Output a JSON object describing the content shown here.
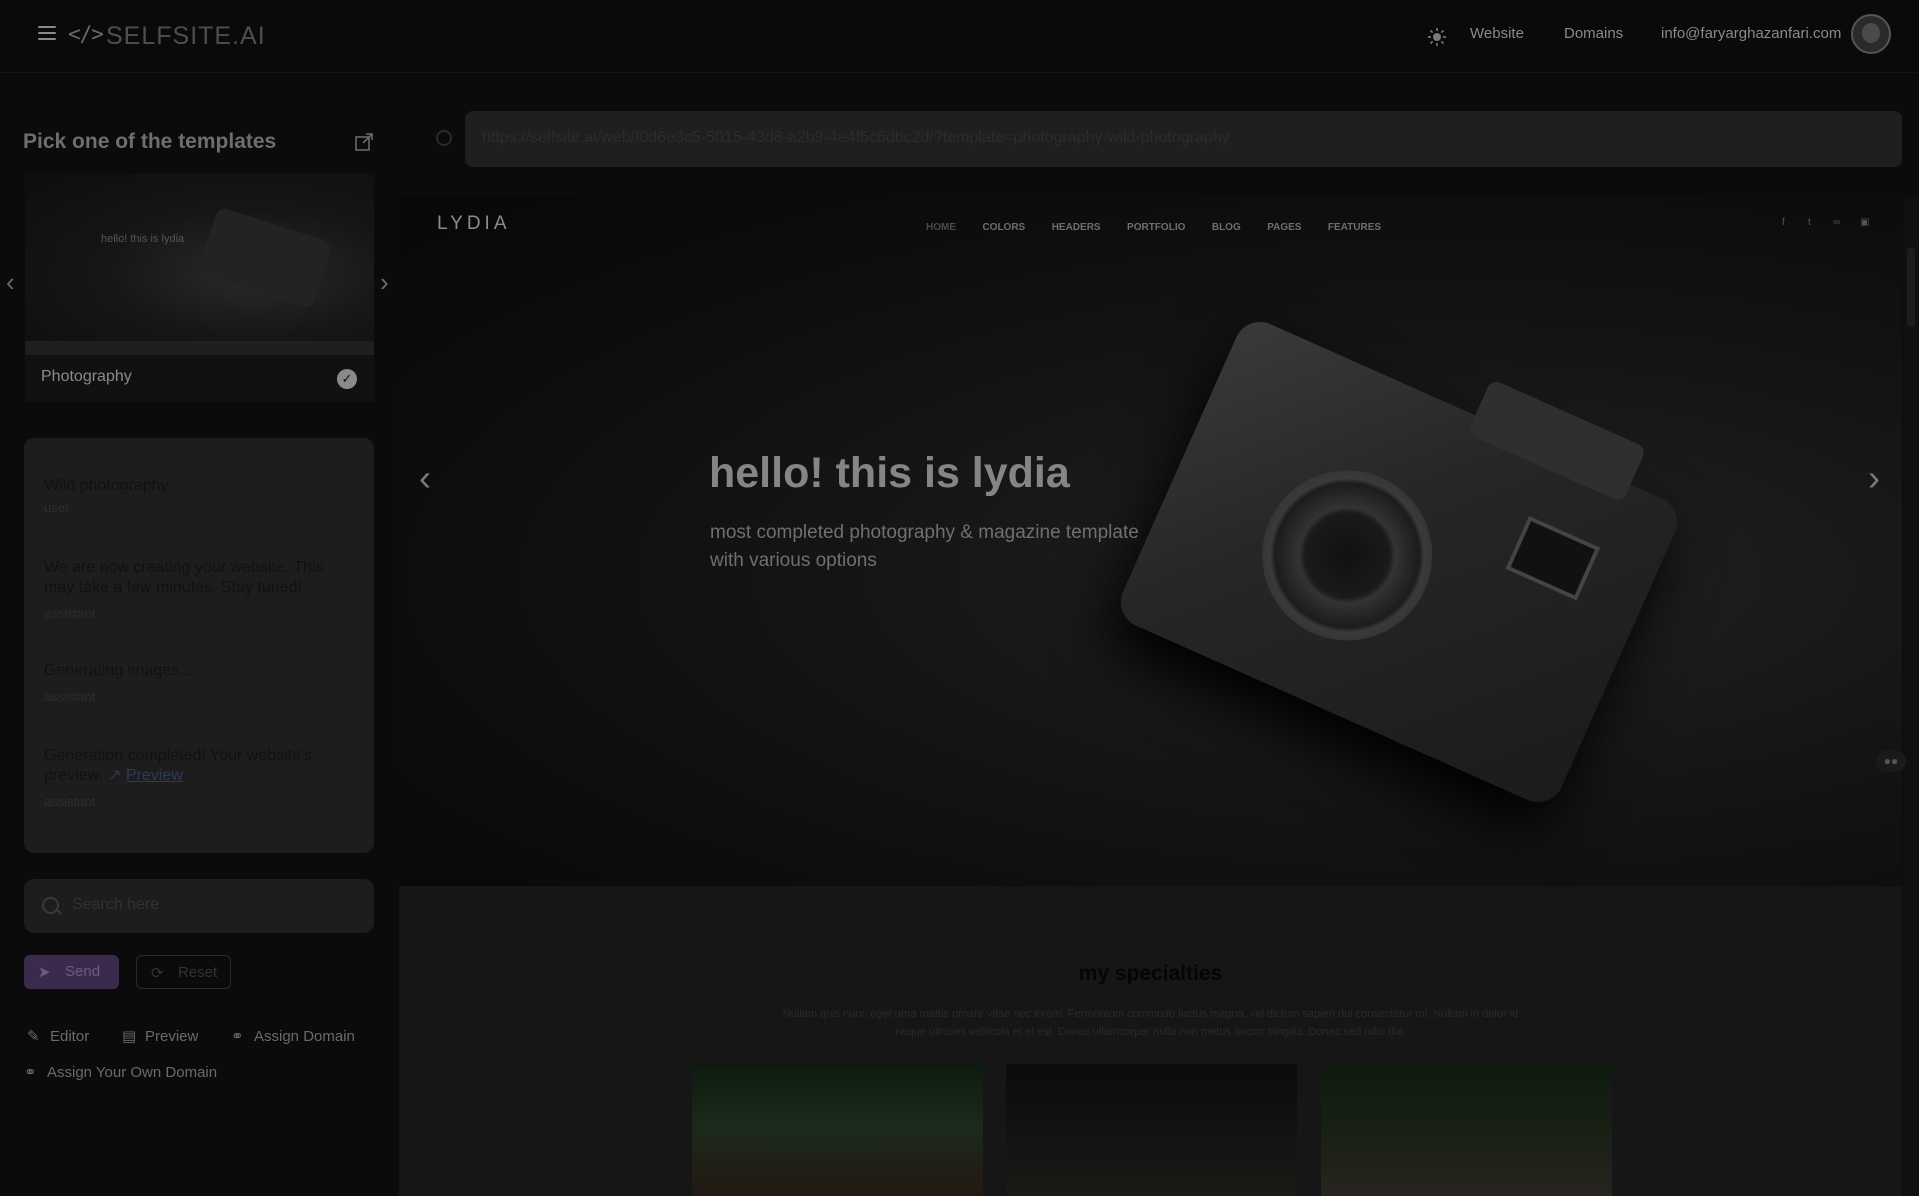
{
  "app": {
    "logo_code": "</>",
    "logo_text": "SELFSITE.AI",
    "nav": [
      "Website",
      "Domains"
    ],
    "user_email": "info@faryarghazanfari.com"
  },
  "left": {
    "title": "Pick one of the templates",
    "template": {
      "label": "Photography",
      "thumb_text": "hello! this is lydia"
    },
    "chat": [
      {
        "text": "Wild photography",
        "role": "user"
      },
      {
        "text": "We are now creating your website. This may take a few minutes. Stay tuned!",
        "role": "assistant"
      },
      {
        "text": "Generating images...",
        "role": "assistant"
      },
      {
        "text": "Generation completed! Your website's preview:",
        "link": "Preview",
        "role": "assistant"
      }
    ],
    "search_placeholder": "Search here",
    "send_label": "Send",
    "reset_label": "Reset",
    "tools": {
      "editor": "Editor",
      "preview": "Preview",
      "assign_domain": "Assign Domain",
      "own_domain": "Assign Your Own Domain"
    }
  },
  "preview": {
    "url": "https://selfsite.ai/web/f0d6e3c5-5015-43d8-a2b9-4e4f5c6dbc2d/?template=photography-wild-photography",
    "site": {
      "logo": "LYDIA",
      "nav": [
        "HOME",
        "COLORS",
        "HEADERS",
        "PORTFOLIO",
        "BLOG",
        "PAGES",
        "FEATURES"
      ],
      "social": [
        "f",
        "t",
        "∞",
        "▣"
      ],
      "hero_title": "hello! this is lydia",
      "hero_subtitle": "most completed photography & magazine template with various options",
      "section_title": "my specialties",
      "section_desc": "Nullam quis nunc eget urna mattis ornare vitae nec lorem. Fermentum commodo luctus magna, vel dictum sapien dui consectetur mi. Nullam in dolor id neque ultricies vehicula et et est. Donec ullamcorper nulla non metus auctor fringilla. Donec sed odio dui."
    }
  },
  "colors": {
    "accent": "#3b2a4c",
    "background": "#0b0b0b"
  }
}
